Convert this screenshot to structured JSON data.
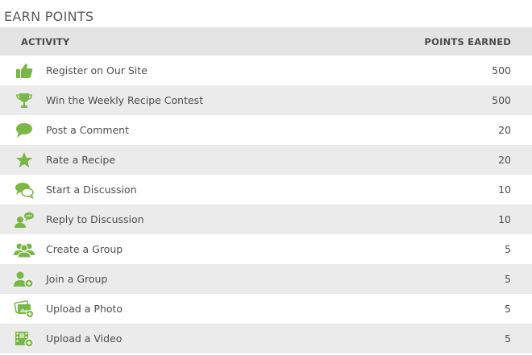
{
  "title": "EARN POINTS",
  "header": {
    "activity": "ACTIVITY",
    "points": "POINTS EARNED"
  },
  "accent_color": "#7ab648",
  "rows": [
    {
      "icon": "thumbs-up-icon",
      "label": "Register on Our Site",
      "points": "500"
    },
    {
      "icon": "trophy-icon",
      "label": "Win the Weekly Recipe Contest",
      "points": "500"
    },
    {
      "icon": "speech-bubble-icon",
      "label": "Post a Comment",
      "points": "20"
    },
    {
      "icon": "star-icon",
      "label": "Rate a Recipe",
      "points": "20"
    },
    {
      "icon": "discussion-bubbles-icon",
      "label": "Start a Discussion",
      "points": "10"
    },
    {
      "icon": "reply-user-icon",
      "label": "Reply to Discussion",
      "points": "10"
    },
    {
      "icon": "group-icon",
      "label": "Create a Group",
      "points": "5"
    },
    {
      "icon": "join-user-icon",
      "label": "Join a Group",
      "points": "5"
    },
    {
      "icon": "photo-upload-icon",
      "label": "Upload a Photo",
      "points": "5"
    },
    {
      "icon": "video-upload-icon",
      "label": "Upload a Video",
      "points": "5"
    }
  ]
}
